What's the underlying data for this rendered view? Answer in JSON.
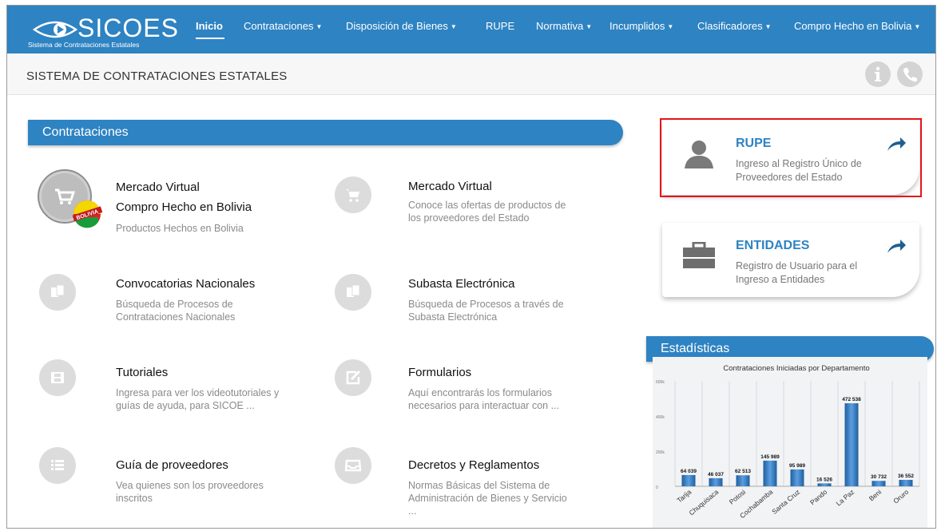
{
  "nav": {
    "logo_text": "SICOES",
    "logo_sub": "Sistema de Contrataciones Estatales",
    "items": [
      {
        "label": "Inicio"
      },
      {
        "label": "Contrataciones"
      },
      {
        "label": "Disposición de Bienes"
      },
      {
        "label": "RUPE"
      },
      {
        "label": "Normativa"
      },
      {
        "label": "Incumplidos"
      },
      {
        "label": "Clasificadores"
      },
      {
        "label": "Compro Hecho en Bolivia"
      }
    ]
  },
  "page_title": "SISTEMA DE CONTRATACIONES ESTATALES",
  "contrataciones": {
    "header": "Contrataciones",
    "items": [
      {
        "title": "Mercado Virtual",
        "title2": "Compro Hecho en Bolivia",
        "desc": "Productos Hechos en Bolivia",
        "badge": "BOLIVIA"
      },
      {
        "title": "Mercado Virtual",
        "desc1": "Conoce las ofertas de productos de",
        "desc2": "los proveedores del Estado"
      },
      {
        "title": "Convocatorias Nacionales",
        "desc1": "Búsqueda de Procesos de",
        "desc2": "Contrataciones Nacionales"
      },
      {
        "title": "Subasta Electrónica",
        "desc1": "Búsqueda de Procesos a través de",
        "desc2": "Subasta Electrónica"
      },
      {
        "title": "Tutoriales",
        "desc1": "Ingresa para ver los videotutoriales y",
        "desc2": "guías de ayuda, para SICOE ..."
      },
      {
        "title": "Formularios",
        "desc1": "Aquí encontrarás los formularios",
        "desc2": "necesarios para interactuar con ..."
      },
      {
        "title": "Guía de proveedores",
        "desc1": "Vea quienes son los proveedores",
        "desc2": "inscritos"
      },
      {
        "title": "Decretos y Reglamentos",
        "desc1": "Normas Básicas del Sistema de",
        "desc2": "Administración de Bienes y Servicio",
        "desc3": "..."
      }
    ]
  },
  "cards": {
    "rupe": {
      "title": "RUPE",
      "desc1": "Ingreso al Registro Único de",
      "desc2": "Proveedores del Estado"
    },
    "entidades": {
      "title": "ENTIDADES",
      "desc1": "Registro de Usuario para el",
      "desc2": "Ingreso a Entidades"
    }
  },
  "estadisticas": {
    "header": "Estadísticas"
  },
  "colors": {
    "primary": "#2e83c2",
    "highlight": "#e8141a",
    "icon_gray": "#dcdcdc"
  },
  "chart_data": {
    "type": "bar",
    "title": "Contrataciones Iniciadas por Departamento",
    "categories": [
      "Tarija",
      "Chuquisaca",
      "Potosi",
      "Cochabamba",
      "Santa Cruz",
      "Pando",
      "La Paz",
      "Beni",
      "Oruro"
    ],
    "values": [
      64039,
      46037,
      62513,
      145989,
      95989,
      16526,
      472538,
      30732,
      36552
    ],
    "labels": [
      "64 039",
      "46 037",
      "62 513",
      "145 989",
      "95 989",
      "16 526",
      "472 538",
      "30 732",
      "36 552"
    ],
    "ylim": [
      0,
      600000
    ],
    "yticks": [
      0,
      200000,
      400000,
      600000
    ],
    "yticklabels": [
      "0",
      "200k",
      "400k",
      "600k"
    ],
    "grid": true
  }
}
